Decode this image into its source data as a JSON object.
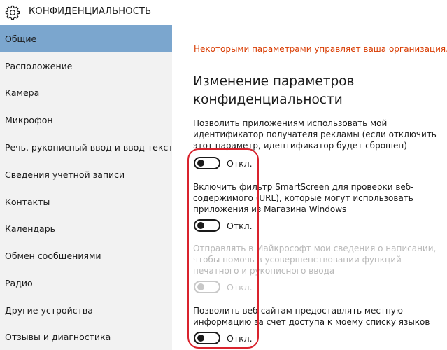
{
  "window": {
    "title": "КОНФИДЕНЦИАЛЬНОСТЬ",
    "icon": "gear-icon"
  },
  "sidebar": {
    "selected_index": 0,
    "items": [
      {
        "label": "Общие"
      },
      {
        "label": "Расположение"
      },
      {
        "label": "Камера"
      },
      {
        "label": "Микрофон"
      },
      {
        "label": "Речь, рукописный ввод и ввод текста"
      },
      {
        "label": "Сведения учетной записи"
      },
      {
        "label": "Контакты"
      },
      {
        "label": "Календарь"
      },
      {
        "label": "Обмен сообщениями"
      },
      {
        "label": "Радио"
      },
      {
        "label": "Другие устройства"
      },
      {
        "label": "Отзывы и диагностика"
      }
    ]
  },
  "main": {
    "org_notice": "Некоторыми параметрами управляет ваша организация.",
    "heading_line1": "Изменение параметров",
    "heading_line2": "конфиденциальности",
    "settings": [
      {
        "desc": "Позволить приложениям использовать мой идентификатор получателя рекламы (если отключить этот параметр, идентификатор будет сброшен)",
        "state_label": "Откл.",
        "enabled": true,
        "on": false
      },
      {
        "desc": "Включить фильтр SmartScreen для проверки веб-содержимого (URL), которые могут использовать приложения из Магазина Windows",
        "state_label": "Откл.",
        "enabled": true,
        "on": false
      },
      {
        "desc": "Отправлять в Майкрософт мои сведения о написании, чтобы помочь в усовершенствовании функций печатного и рукописного ввода",
        "state_label": "Откл.",
        "enabled": false,
        "on": false
      },
      {
        "desc": "Позволить веб-сайтам предоставлять местную информацию за счет доступа к моему списку языков",
        "state_label": "Откл.",
        "enabled": true,
        "on": false
      }
    ]
  },
  "colors": {
    "accent_selected": "#7ba6ce",
    "notice": "#d83b01",
    "highlight_outline": "#d9232d"
  }
}
